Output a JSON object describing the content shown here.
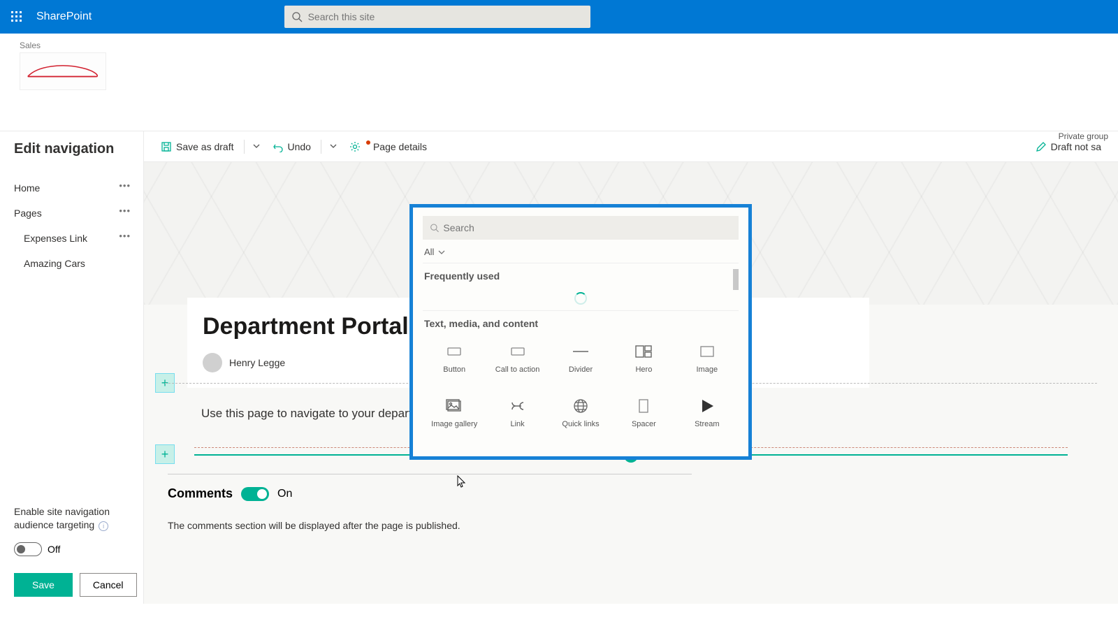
{
  "topbar": {
    "product": "SharePoint",
    "search_placeholder": "Search this site"
  },
  "site": {
    "label": "Sales",
    "group_type": "Private group"
  },
  "nav": {
    "heading": "Edit navigation",
    "items": [
      "Home",
      "Pages",
      "Expenses Link",
      "Amazing Cars"
    ],
    "audience_label": "Enable site navigation audience targeting",
    "audience_state": "Off",
    "save_label": "Save",
    "cancel_label": "Cancel"
  },
  "commands": {
    "save_draft": "Save as draft",
    "undo": "Undo",
    "page_details": "Page details",
    "draft_status": "Draft not sa"
  },
  "page": {
    "title": "Department Portals",
    "author": "Henry Legge",
    "body_text": "Use this page to navigate to your department portals",
    "comments_heading": "Comments",
    "comments_state": "On",
    "comments_note": "The comments section will be displayed after the page is published."
  },
  "picker": {
    "search_placeholder": "Search",
    "filter": "All",
    "section_frequent": "Frequently used",
    "section_text": "Text, media, and content",
    "items": [
      "Button",
      "Call to action",
      "Divider",
      "Hero",
      "Image",
      "Image gallery",
      "Link",
      "Quick links",
      "Spacer",
      "Stream"
    ]
  }
}
